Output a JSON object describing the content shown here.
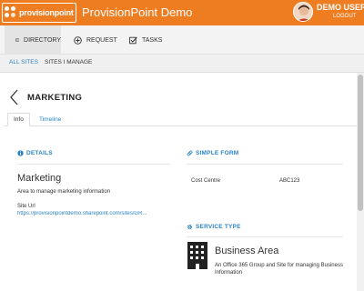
{
  "header": {
    "logo_text": "provisionpoint",
    "app_title": "ProvisionPoint Demo",
    "user_name": "DEMO USER",
    "logout_label": "LOGOUT"
  },
  "nav": {
    "tabs": [
      {
        "label": "DIRECTORY",
        "icon": "list-icon",
        "active": true
      },
      {
        "label": "REQUEST",
        "icon": "plus-circle-icon",
        "active": false
      },
      {
        "label": "TASKS",
        "icon": "checkbox-icon",
        "active": false
      }
    ]
  },
  "subnav": {
    "items": [
      {
        "label": "ALL SITES",
        "active": true
      },
      {
        "label": "SITES I MANAGE",
        "active": false
      }
    ]
  },
  "page": {
    "title": "MARKETING",
    "tabs": [
      {
        "label": "Info",
        "active": true
      },
      {
        "label": "Timeline",
        "active": false
      }
    ]
  },
  "details": {
    "heading": "DETAILS",
    "name": "Marketing",
    "description": "Area to manage marketing information",
    "site_url_label": "Site Url",
    "site_url": "https://provisionpointdemo.sharepoint.com/sites/GR..."
  },
  "simple_form": {
    "heading": "SIMPLE FORM",
    "fields": [
      {
        "label": "Cost Centre",
        "value": "ABC123"
      }
    ]
  },
  "service_type": {
    "heading": "SERVICE TYPE",
    "title": "Business Area",
    "description": "An Office 365 Group and Site for managing Business Information"
  },
  "colors": {
    "brand_orange": "#ee7d21",
    "link_blue": "#2c83c3"
  }
}
